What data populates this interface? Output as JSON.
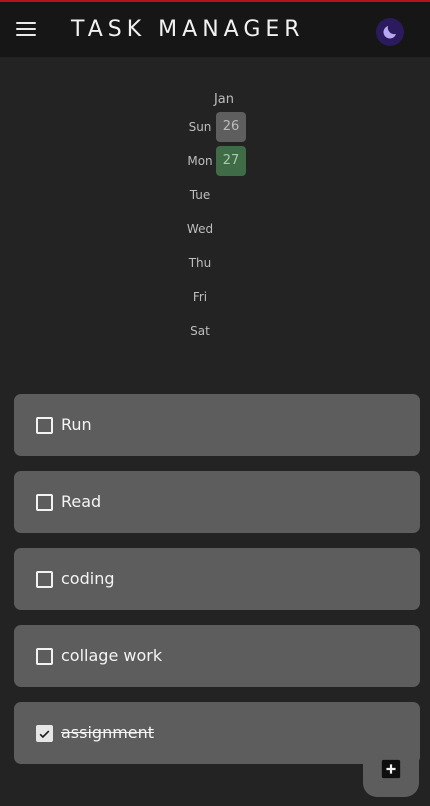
{
  "header": {
    "title": "TASK MANAGER",
    "menu_icon": "hamburger-menu-icon",
    "theme_icon": "moon-icon",
    "accent": "#b3121f",
    "theme_button_color": "#2b1a5e"
  },
  "calendar": {
    "month": "Jan",
    "days": [
      {
        "day": "Sun",
        "date": "26",
        "state": "grey"
      },
      {
        "day": "Mon",
        "date": "27",
        "state": "today"
      },
      {
        "day": "Tue",
        "date": ""
      },
      {
        "day": "Wed",
        "date": ""
      },
      {
        "day": "Thu",
        "date": ""
      },
      {
        "day": "Fri",
        "date": ""
      },
      {
        "day": "Sat",
        "date": ""
      }
    ]
  },
  "tasks": [
    {
      "label": "Run",
      "checked": false
    },
    {
      "label": "Read",
      "checked": false
    },
    {
      "label": "coding",
      "checked": false
    },
    {
      "label": "collage work",
      "checked": false
    },
    {
      "label": "assignment",
      "checked": true
    }
  ],
  "fab": {
    "icon": "add-box-icon"
  }
}
